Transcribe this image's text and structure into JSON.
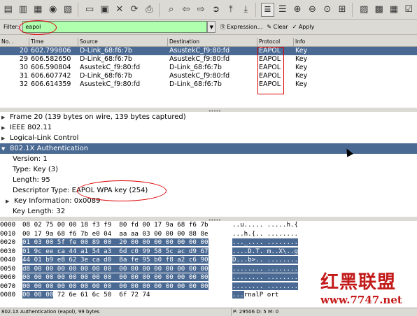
{
  "toolbar": {
    "icons": [
      "interface-list-icon",
      "capture-options-icon",
      "start-capture-icon",
      "stop-capture-icon",
      "restart-capture-icon",
      "open-icon",
      "save-icon",
      "close-icon",
      "reload-icon",
      "print-icon",
      "find-icon",
      "back-icon",
      "forward-icon",
      "goto-icon",
      "first-icon",
      "last-icon",
      "colorize-icon",
      "autoscroll-icon",
      "zoom-in-icon",
      "zoom-out-icon",
      "normal-size-icon",
      "resize-columns-icon",
      "capture-filters-icon",
      "display-filters-icon",
      "coloring-rules-icon",
      "preferences-icon"
    ]
  },
  "filter": {
    "label": "Filter:",
    "value": "eapol",
    "expression_label": "Expression...",
    "clear_label": "Clear",
    "apply_label": "Apply"
  },
  "packet_list": {
    "columns": [
      "No. .",
      "Time",
      "Source",
      "Destination",
      "Protocol",
      "Info"
    ],
    "rows": [
      {
        "no": "20",
        "time": "602.799806",
        "source": "D-Link_68:f6:7b",
        "destination": "AsustekC_f9:80:fd",
        "protocol": "EAPOL",
        "info": "Key",
        "selected": true
      },
      {
        "no": "29",
        "time": "606.582650",
        "source": "D-Link_68:f6:7b",
        "destination": "AsustekC_f9:80:fd",
        "protocol": "EAPOL",
        "info": "Key",
        "selected": false
      },
      {
        "no": "30",
        "time": "606.590804",
        "source": "AsustekC_f9:80:fd",
        "destination": "D-Link_68:f6:7b",
        "protocol": "EAPOL",
        "info": "Key",
        "selected": false
      },
      {
        "no": "31",
        "time": "606.607742",
        "source": "D-Link_68:f6:7b",
        "destination": "AsustekC_f9:80:fd",
        "protocol": "EAPOL",
        "info": "Key",
        "selected": false
      },
      {
        "no": "32",
        "time": "606.614359",
        "source": "AsustekC_f9:80:fd",
        "destination": "D-Link_68:f6:7b",
        "protocol": "EAPOL",
        "info": "Key",
        "selected": false
      }
    ]
  },
  "details": {
    "frame": "Frame 20 (139 bytes on wire, 139 bytes captured)",
    "ieee": "IEEE 802.11",
    "llc": "Logical-Link Control",
    "dot1x": "802.1X Authentication",
    "version": "Version: 1",
    "type": "Type: Key (3)",
    "length": "Length: 95",
    "descriptor_label": "Descriptor Type:",
    "descriptor_value": "EAPOL WPA key (254)",
    "key_info": "Key Information: 0x0089",
    "key_length": "Key Length: 32"
  },
  "hex": [
    {
      "off": "0000",
      "plain": "08 02 75 00 00 18 f3 f9  80 fd 00 17 9a 68 f6 7b",
      "hl": "",
      "tail": "",
      "ascii": "..u..... .....h.{",
      "ascii_hl": ""
    },
    {
      "off": "0010",
      "plain": "00 17 9a 68 f6 7b e0 04  aa aa 03 00 00 00 88 8e",
      "hl": "",
      "tail": "",
      "ascii": "...h.{.. ........",
      "ascii_hl": ""
    },
    {
      "off": "0020",
      "plain": "",
      "hl": "01 03 00 5f fe 00 89 00  20 00 00 00 00 00 00 00",
      "tail": "",
      "ascii": "",
      "ascii_hl": "..._.... ........"
    },
    {
      "off": "0030",
      "plain": "",
      "hl": "01 9c ee ca 44 a1 54 a3  6d c0 99 58 5c ac d9 67",
      "tail": "",
      "ascii": "",
      "ascii_hl": "....D.T. m..X\\..g"
    },
    {
      "off": "0040",
      "plain": "",
      "hl": "44 01 b9 e8 62 3e ca d0  8a fe 95 b0 f8 a2 c6 90",
      "tail": "",
      "ascii": "",
      "ascii_hl": "D...b>.. ........"
    },
    {
      "off": "0050",
      "plain": "",
      "hl": "d8 00 00 00 00 00 00 00  00 00 00 00 00 00 00 00",
      "tail": "",
      "ascii": "",
      "ascii_hl": "........ ........"
    },
    {
      "off": "0060",
      "plain": "",
      "hl": "00 00 00 00 00 00 00 00  00 00 00 00 00 00 00 00",
      "tail": "",
      "ascii": "",
      "ascii_hl": "........ ........"
    },
    {
      "off": "0070",
      "plain": "",
      "hl": "00 00 00 00 00 00 00 00  00 00 00 00 00 00 00 00",
      "tail": "",
      "ascii": "",
      "ascii_hl": "........ ........"
    },
    {
      "off": "0080",
      "plain": "",
      "hl": "00 00 00",
      "tail": " 72 6e 61 6c 50  6f 72 74",
      "ascii": "rnalP ort",
      "ascii_hl": "..."
    }
  ],
  "status": {
    "left": "802.1X Authentication (eapol), 99 bytes",
    "right": "P: 29506 D: 5 M: 0"
  },
  "watermark": {
    "logo_text": "红黑联盟",
    "url": "www.7747.net"
  }
}
